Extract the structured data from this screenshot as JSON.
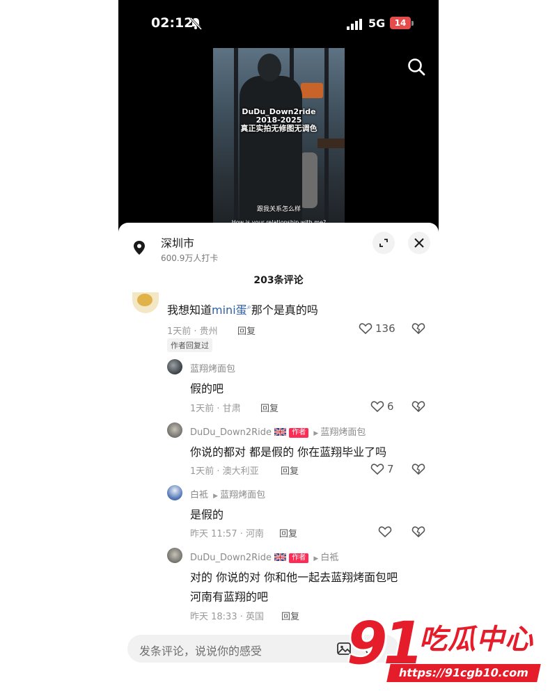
{
  "status_bar": {
    "time": "02:12",
    "network": "5G",
    "battery": "14"
  },
  "video": {
    "watermark_line1": "DuDu_Down2ride",
    "watermark_line2": "2018-2025",
    "watermark_line3": "真正实拍无修图无调色",
    "subtitle_cn": "跟我关系怎么样",
    "subtitle_en": "How is your relationship with me?"
  },
  "location": {
    "name": "深圳市",
    "checkins": "600.9万人打卡"
  },
  "comments_header": "203条评论",
  "comments": [
    {
      "text_before": "我想知道",
      "link": "mini蛋",
      "text_after": "那个是真的吗",
      "meta": "1天前 · 贵州",
      "reply": "回复",
      "likes": "136",
      "badge": "作者回复过"
    }
  ],
  "replies": [
    {
      "user": "蓝翔烤面包",
      "text": "假的吧",
      "meta": "1天前 · 甘肃",
      "reply": "回复",
      "likes": "6"
    },
    {
      "user": "DuDu_Down2Ride",
      "author_tag": "作者",
      "reply_to": "蓝翔烤面包",
      "text": "你说的都对 都是假的 你在蓝翔毕业了吗",
      "meta": "1天前 · 澳大利亚",
      "reply": "回复",
      "likes": "7"
    },
    {
      "user": "白袛",
      "reply_to": "蓝翔烤面包",
      "text": "是假的",
      "meta": "昨天 11:57 · 河南",
      "reply": "回复",
      "likes": ""
    },
    {
      "user": "DuDu_Down2Ride",
      "author_tag": "作者",
      "reply_to": "白袛",
      "text_line1": "对的 你说的对 你和他一起去蓝翔烤面包吧",
      "text_line2": "河南有蓝翔的吧",
      "meta": "昨天 18:33 · 英国",
      "reply": "回复"
    }
  ],
  "input": {
    "placeholder": "发条评论，说说你的感受"
  },
  "brand": {
    "number": "91",
    "name": "吃瓜中心",
    "url": "https://91cgb10.com"
  },
  "colors": {
    "accent": "#fe2c55",
    "link": "#2f5fa8",
    "brand": "#e51d2a",
    "battery": "#e44d4b"
  }
}
